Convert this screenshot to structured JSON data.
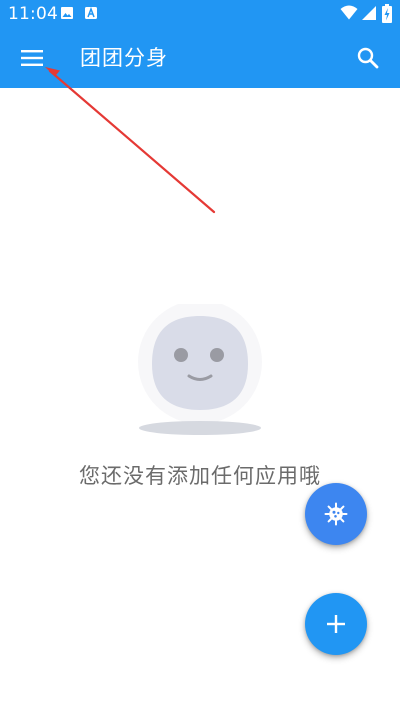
{
  "status_bar": {
    "time": "11:04",
    "left_icons": [
      "image-icon",
      "app-notification-icon"
    ],
    "right_icons": [
      "wifi-icon",
      "signal-icon",
      "battery-charging-icon"
    ]
  },
  "app_bar": {
    "title": "团团分身",
    "menu_icon": "menu-icon",
    "search_icon": "search-icon",
    "background_color": "#2196f3"
  },
  "empty_state": {
    "message": "您还没有添加任何应用哦",
    "illustration": "empty-face-illustration"
  },
  "fabs": {
    "settings_icon": "virus-gear-icon",
    "add_icon": "plus-icon"
  },
  "colors": {
    "primary": "#2196f3",
    "fab_settings": "#3d86f0",
    "annotation_arrow": "#e53935",
    "message_text": "#6b6b6b"
  }
}
